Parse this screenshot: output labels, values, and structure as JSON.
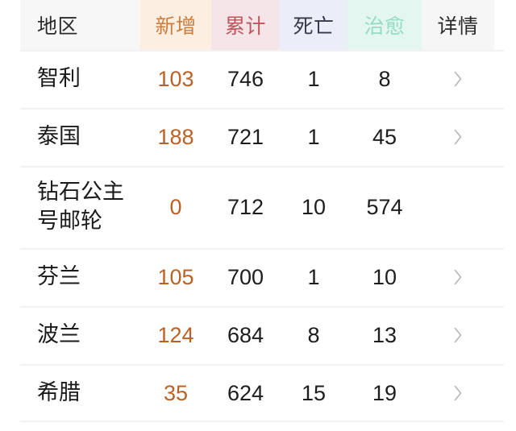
{
  "tab_indicator": {
    "color": "#e05a58"
  },
  "table": {
    "columns": [
      {
        "key": "region",
        "label": "地区",
        "tint": "#f7f7f8",
        "text_color": "#2b2b2b"
      },
      {
        "key": "new",
        "label": "新增",
        "tint": "#fcefe1",
        "text_color": "#cd7c3c"
      },
      {
        "key": "total",
        "label": "累计",
        "tint": "#f5e5e8",
        "text_color": "#c0545f"
      },
      {
        "key": "death",
        "label": "死亡",
        "tint": "#ebeef8",
        "text_color": "#33384a"
      },
      {
        "key": "cured",
        "label": "治愈",
        "tint": "#e3f6ef",
        "text_color": "#93dcc6"
      },
      {
        "key": "detail",
        "label": "详情",
        "tint": "#f6f6f7",
        "text_color": "#2b2b2b"
      }
    ],
    "rows": [
      {
        "region": "智利",
        "new": "103",
        "total": "746",
        "death": "1",
        "cured": "8",
        "detail_icon": "chevron-right-icon"
      },
      {
        "region": "泰国",
        "new": "188",
        "total": "721",
        "death": "1",
        "cured": "45",
        "detail_icon": "chevron-right-icon"
      },
      {
        "region": "钻石公主号邮轮",
        "new": "0",
        "total": "712",
        "death": "10",
        "cured": "574",
        "detail_icon": ""
      },
      {
        "region": "芬兰",
        "new": "105",
        "total": "700",
        "death": "1",
        "cured": "10",
        "detail_icon": "chevron-right-icon"
      },
      {
        "region": "波兰",
        "new": "124",
        "total": "684",
        "death": "8",
        "cured": "13",
        "detail_icon": "chevron-right-icon"
      },
      {
        "region": "希腊",
        "new": "35",
        "total": "624",
        "death": "15",
        "cured": "19",
        "detail_icon": "chevron-right-icon"
      }
    ],
    "value_colors": {
      "new": "#bc6126",
      "total": "#1d1d1f",
      "death": "#1d1d1f",
      "cured": "#1d1d1f"
    }
  }
}
